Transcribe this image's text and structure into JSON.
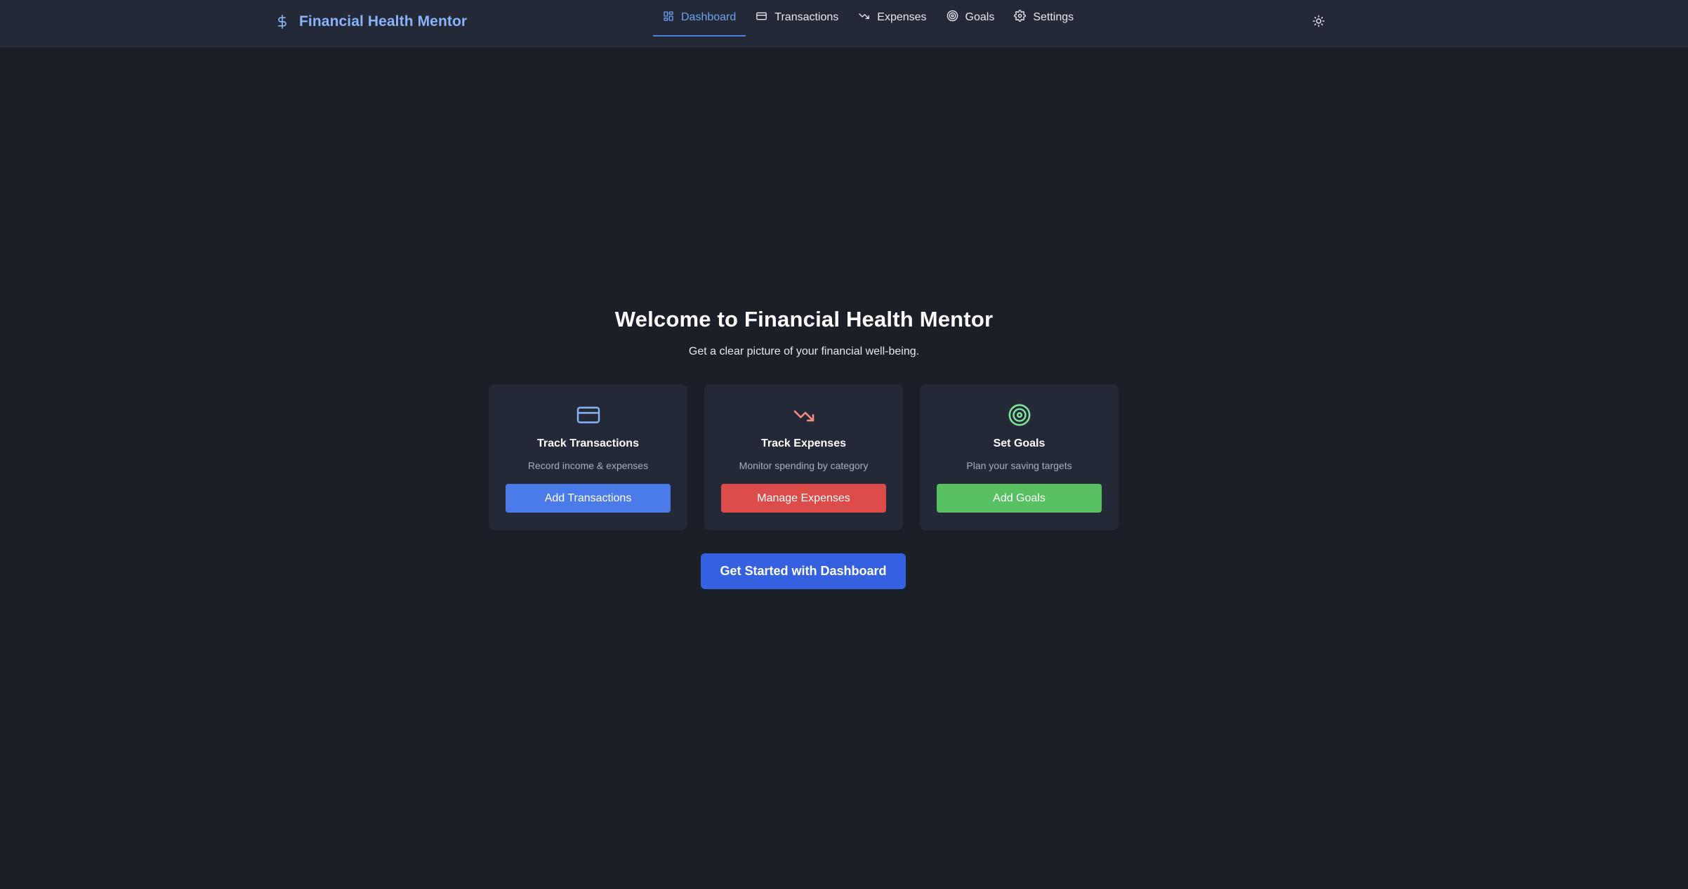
{
  "brand": {
    "name": "Financial Health Mentor",
    "icon": "dollar-icon",
    "color": "#8ab4f8"
  },
  "nav": {
    "items": [
      {
        "label": "Dashboard",
        "icon": "dashboard-icon",
        "active": true
      },
      {
        "label": "Transactions",
        "icon": "card-icon",
        "active": false
      },
      {
        "label": "Expenses",
        "icon": "trending-down-icon",
        "active": false
      },
      {
        "label": "Goals",
        "icon": "target-icon",
        "active": false
      },
      {
        "label": "Settings",
        "icon": "gear-icon",
        "active": false
      }
    ],
    "theme_toggle_icon": "sun-icon"
  },
  "hero": {
    "title": "Welcome to Financial Health Mentor",
    "subtitle": "Get a clear picture of your financial well-being."
  },
  "cards": [
    {
      "icon": "credit-card-icon",
      "title": "Track Transactions",
      "description": "Record income & expenses",
      "button": "Add Transactions",
      "button_color": "#4b7be8",
      "icon_color": "#8ab4f8"
    },
    {
      "icon": "trending-down-icon",
      "title": "Track Expenses",
      "description": "Monitor spending by category",
      "button": "Manage Expenses",
      "button_color": "#dc4c4a",
      "icon_color": "#f28b82"
    },
    {
      "icon": "target-icon",
      "title": "Set Goals",
      "description": "Plan your saving targets",
      "button": "Add Goals",
      "button_color": "#58bf63",
      "icon_color": "#81e39a"
    }
  ],
  "cta": {
    "label": "Get Started with Dashboard",
    "color": "#3560e0"
  },
  "colors": {
    "background": "#1b1f28",
    "surface": "#232936",
    "accent": "#6fa3f5"
  }
}
